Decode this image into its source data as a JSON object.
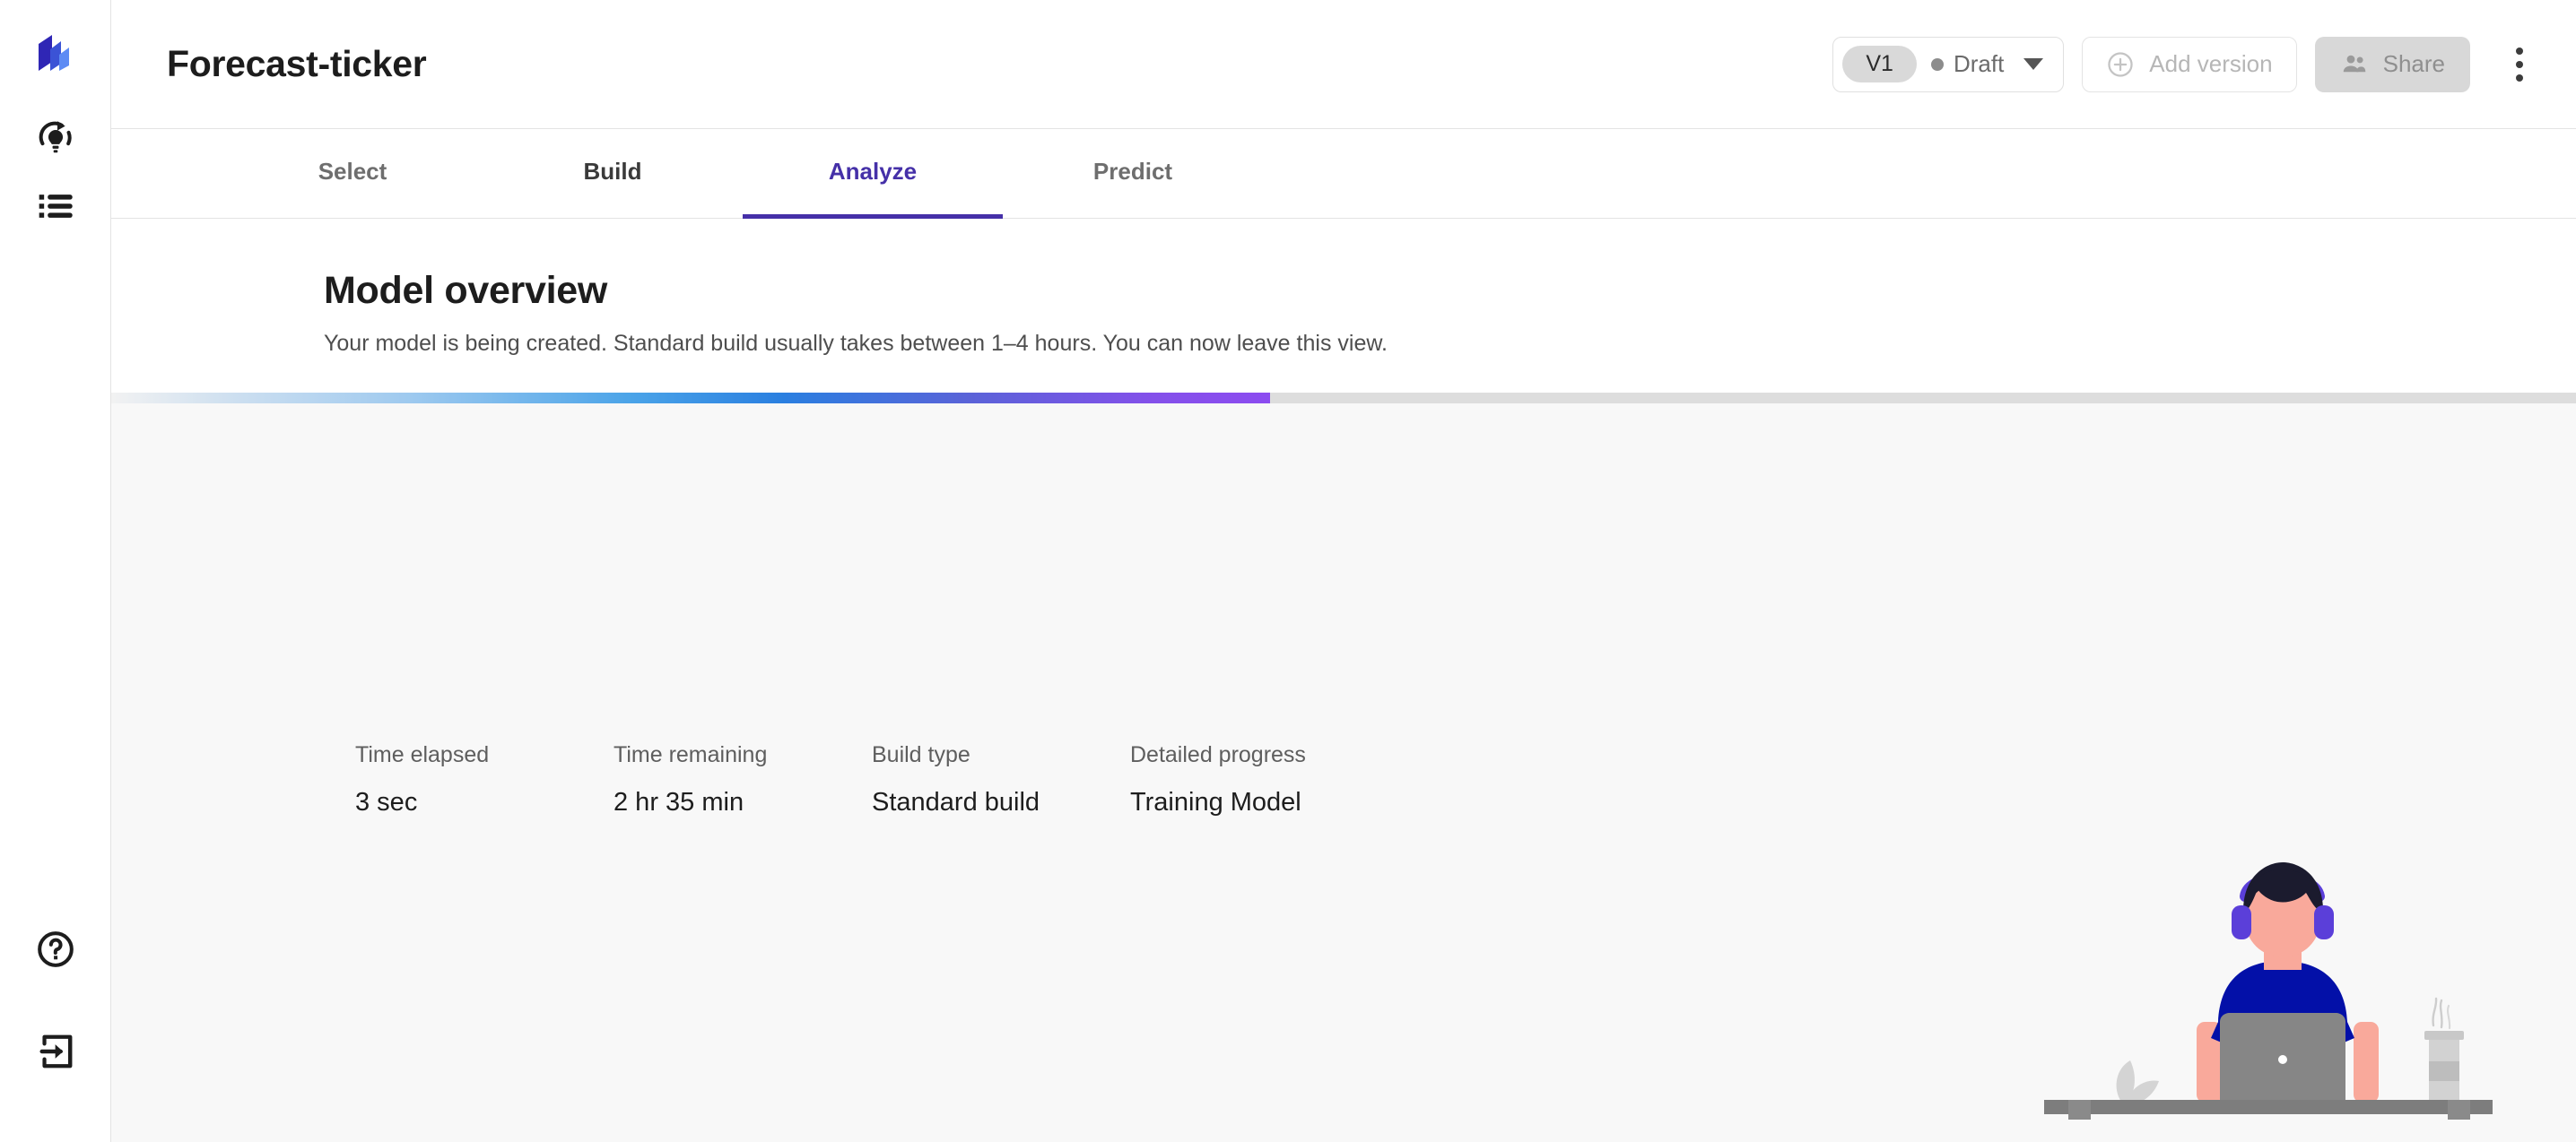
{
  "app": {
    "logo_name": "stacked-panels-logo"
  },
  "sidebar": {
    "items": [
      {
        "id": "model",
        "icon": "lightbulb-refresh-icon",
        "label": "Model"
      },
      {
        "id": "list",
        "icon": "list-icon",
        "label": "Projects"
      }
    ],
    "bottom_items": [
      {
        "id": "help",
        "icon": "help-circle-icon",
        "label": "Help"
      },
      {
        "id": "logout",
        "icon": "logout-icon",
        "label": "Log out"
      }
    ]
  },
  "header": {
    "title": "Forecast-ticker",
    "version": {
      "badge": "V1",
      "status": "Draft",
      "status_color": "#8c8c8c"
    },
    "add_version_label": "Add version",
    "share_label": "Share",
    "more_menu_label": "More options"
  },
  "tabs": [
    {
      "label": "Select",
      "active": false
    },
    {
      "label": "Build",
      "active": false
    },
    {
      "label": "Analyze",
      "active": true
    },
    {
      "label": "Predict",
      "active": false
    }
  ],
  "main": {
    "title": "Model overview",
    "subtitle": "Your model is being created. Standard build usually takes between 1–4 hours. You can now leave this view.",
    "progress": {
      "percent": 47,
      "track_color": "#dddddd",
      "accent_start": "#f2f2f2",
      "accent_end": "#8c4cf0"
    },
    "stats": [
      {
        "label": "Time elapsed",
        "value": "3 sec"
      },
      {
        "label": "Time remaining",
        "value": "2 hr 35 min"
      },
      {
        "label": "Build type",
        "value": "Standard build"
      },
      {
        "label": "Detailed progress",
        "value": "Training Model"
      }
    ],
    "illustration": {
      "name": "person-at-laptop-illustration",
      "hair_color": "#1b1b2e",
      "headphone_color": "#5b3fd9",
      "skin_color": "#f9a99b",
      "shirt_color": "#0310a8",
      "laptop_color": "#868686",
      "desk_color": "#7d7d7d",
      "cup_color": "#cfcfcf",
      "plant_color": "#d4d4d4"
    }
  },
  "theme": {
    "accent": "#4530a8",
    "text_primary": "#1d1d1d",
    "text_muted": "#6e6e6e",
    "panel_bg": "#f8f8f8",
    "border": "#e3e3e3"
  }
}
